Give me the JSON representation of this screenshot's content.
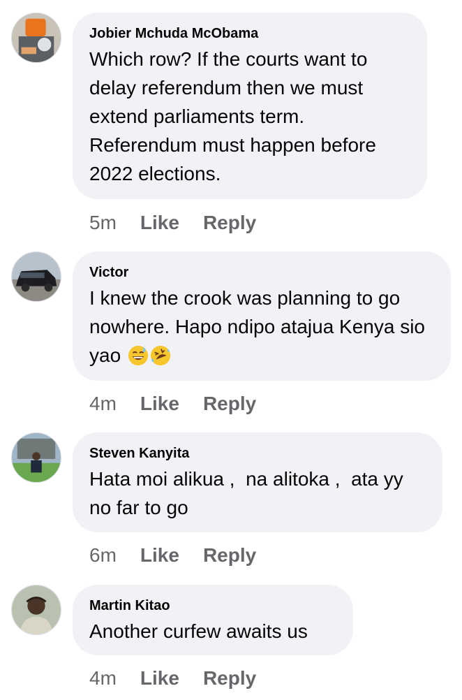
{
  "comments": [
    {
      "author": "Jobier Mchuda McObama",
      "text": "Which row? If the courts want to delay referendum then we must extend parliaments term. Referendum must happen before 2022 elections.",
      "time": "5m",
      "like": "Like",
      "reply": "Reply",
      "avatar": "avatar-orange-figure"
    },
    {
      "author": "Victor",
      "text": "I knew the crook was planning to go nowhere. Hapo ndipo atajua Kenya sio yao",
      "emojis": [
        "grinning-sweat-emoji",
        "rolling-laughing-emoji"
      ],
      "time": "4m",
      "like": "Like",
      "reply": "Reply",
      "avatar": "avatar-black-suv"
    },
    {
      "author": "Steven Kanyita",
      "text": "Hata moi alikua ,  na alitoka ,  ata yy no far to go",
      "time": "6m",
      "like": "Like",
      "reply": "Reply",
      "avatar": "avatar-man-lawn"
    },
    {
      "author": "Martin Kitao",
      "text": "Another curfew awaits us",
      "time": "4m",
      "like": "Like",
      "reply": "Reply",
      "avatar": "avatar-man-portrait"
    }
  ],
  "colors": {
    "bubble": "#f0f2f5",
    "secondary_text": "#65676b",
    "primary_text": "#050505"
  }
}
